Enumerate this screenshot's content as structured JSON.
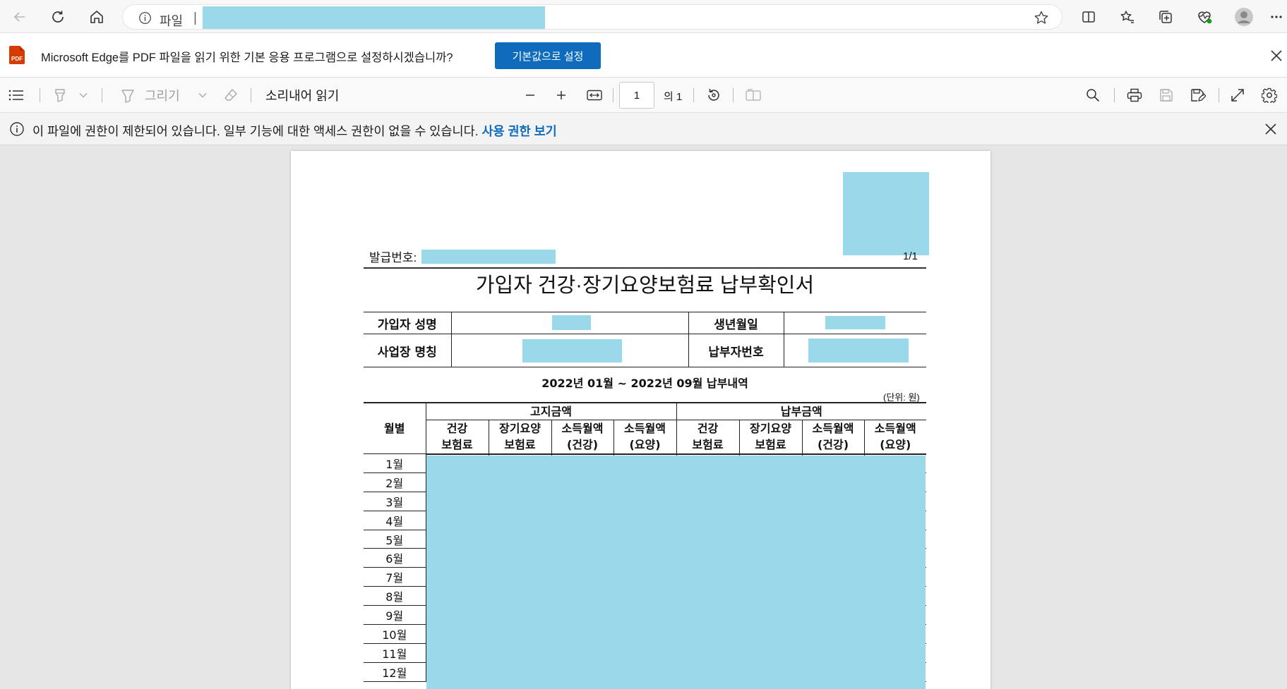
{
  "browser": {
    "address_label": "파일",
    "address_separator": "|"
  },
  "default_app_bar": {
    "badge_text": "PDF",
    "message": "Microsoft Edge를 PDF 파일을 읽기 위한 기본 응용 프로그램으로 설정하시겠습니까?",
    "button_label": "기본값으로 설정"
  },
  "pdf_toolbar": {
    "draw_label": "그리기",
    "read_aloud_label": "소리내어 읽기",
    "page_number": "1",
    "page_of": "의 1"
  },
  "restriction_bar": {
    "message": "이 파일에 권한이 제한되어 있습니다. 일부 기능에 대한 액세스 권한이 없을 수 있습니다.",
    "link_label": "사용 권한 보기"
  },
  "document": {
    "issue_label": "발급번호:",
    "page_count": "1/1",
    "title": "가입자 건강·장기요양보험료 납부확인서",
    "info": {
      "subscriber_name_label": "가입자 성명",
      "birth_label": "생년월일",
      "workplace_label": "사업장 명칭",
      "payer_no_label": "납부자번호"
    },
    "period_title": "2022년 01월 ~ 2022년 09월 납부내역",
    "unit": "(단위: 원)",
    "table": {
      "month_header": "월별",
      "notice_group": "고지금액",
      "paid_group": "납부금액",
      "columns": [
        [
          "건강",
          "보험료"
        ],
        [
          "장기요양",
          "보험료"
        ],
        [
          "소득월액",
          "(건강)"
        ],
        [
          "소득월액",
          "(요양)"
        ],
        [
          "건강",
          "보험료"
        ],
        [
          "장기요양",
          "보험료"
        ],
        [
          "소득월액",
          "(건강)"
        ],
        [
          "소득월액",
          "(요양)"
        ]
      ],
      "months": [
        "1월",
        "2월",
        "3월",
        "4월",
        "5월",
        "6월",
        "7월",
        "8월",
        "9월",
        "10월",
        "11월",
        "12월"
      ]
    }
  },
  "colors": {
    "redaction": "#9ad9ea",
    "accent": "#0f6cbd",
    "pdf_badge": "#d83b01"
  }
}
